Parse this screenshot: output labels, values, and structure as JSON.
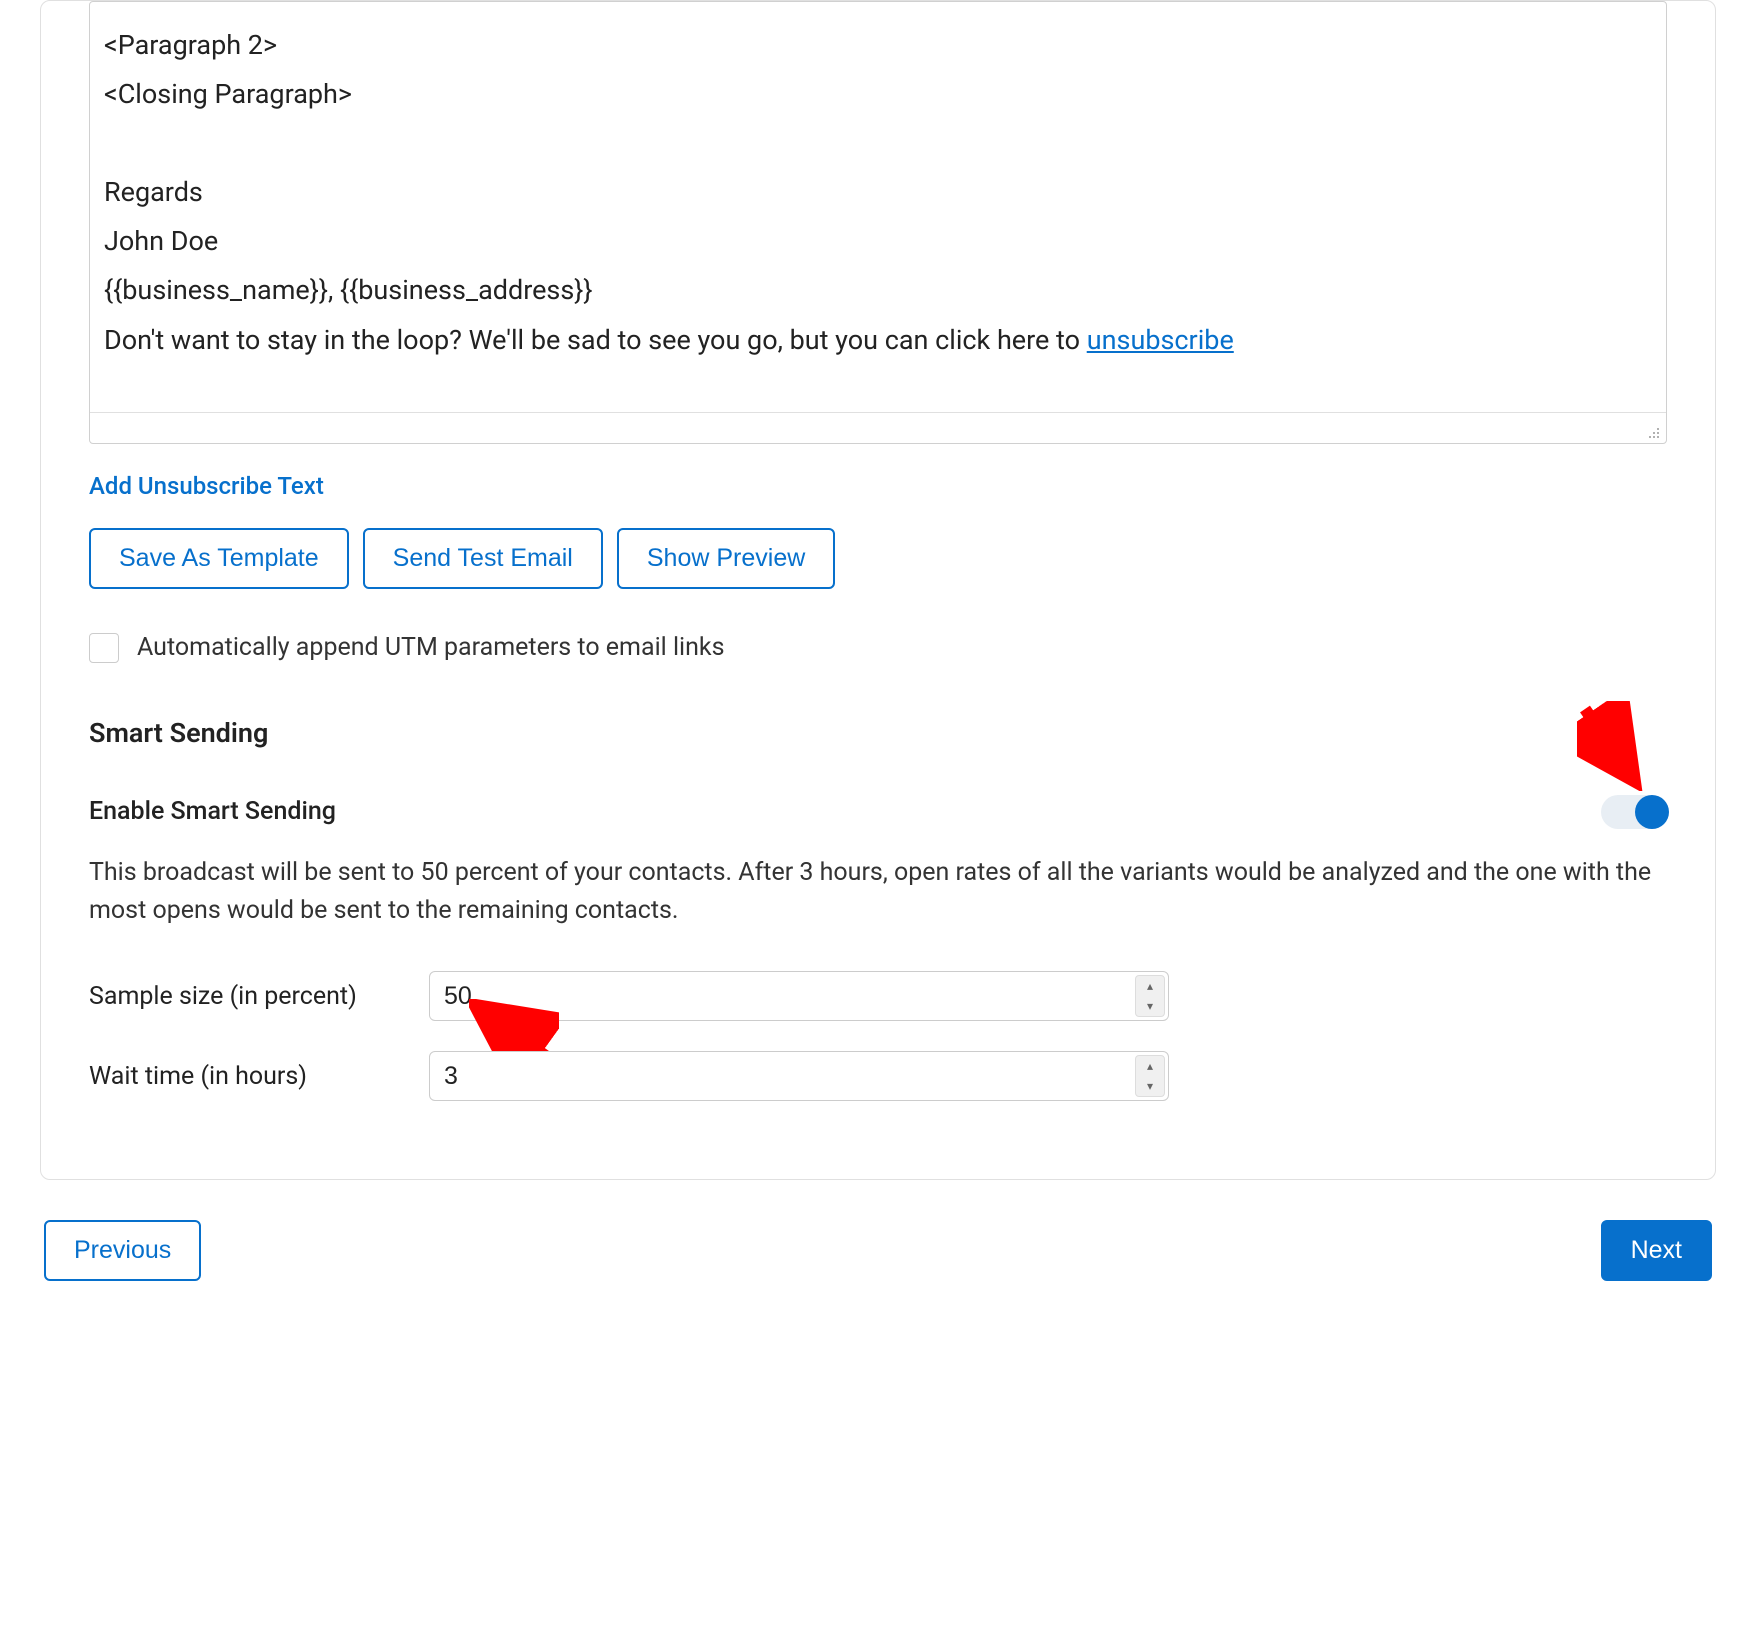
{
  "editor": {
    "para2": "<Paragraph 2>",
    "closing": "<Closing Paragraph>",
    "regards": "Regards",
    "name": "John Doe",
    "merge": "{{business_name}}, {{business_address}}",
    "unsub_prefix": "Don't want to stay in the loop? We'll be sad to see you go, but you can click here to ",
    "unsub_link": "unsubscribe"
  },
  "links": {
    "add_unsub": "Add Unsubscribe Text"
  },
  "buttons": {
    "save_template": "Save As Template",
    "send_test": "Send Test Email",
    "show_preview": "Show Preview",
    "previous": "Previous",
    "next": "Next"
  },
  "utm": {
    "label": "Automatically append UTM parameters to email links",
    "checked": false
  },
  "smart": {
    "title": "Smart Sending",
    "enable_label": "Enable Smart Sending",
    "enabled": true,
    "description": "This broadcast will be sent to 50 percent of your contacts. After 3 hours, open rates of all the variants would be analyzed and the one with the most opens would be sent to the remaining contacts.",
    "sample_label": "Sample size (in percent)",
    "sample_value": "50",
    "wait_label": "Wait time (in hours)",
    "wait_value": "3"
  }
}
